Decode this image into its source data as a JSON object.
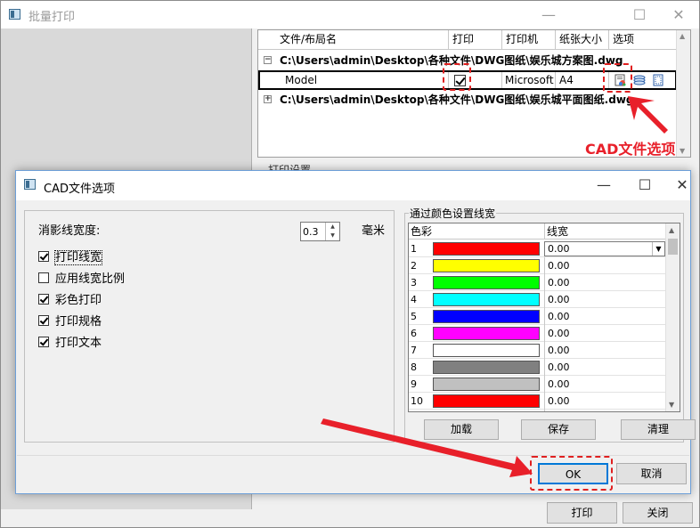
{
  "main_window": {
    "title": "批量打印",
    "controls": {
      "minimize": "—",
      "maximize": "☐",
      "close": "✕"
    },
    "file_tree": {
      "columns": [
        "文件/布局名",
        "打印",
        "打印机",
        "纸张大小",
        "选项"
      ],
      "rows": [
        {
          "expander": "−",
          "path": "C:\\Users\\admin\\Desktop\\各种文件\\DWG图纸\\娱乐城方案图.dwg"
        },
        {
          "layout": "Model",
          "print_checked": true,
          "printer": "Microsoft",
          "paper": "A4",
          "options_icons": [
            "cad-file-options-icon",
            "layers-icon",
            "page-setup-icon"
          ]
        },
        {
          "expander": "+",
          "path": "C:\\Users\\admin\\Desktop\\各种文件\\DWG图纸\\娱乐城平面图纸.dwg"
        }
      ]
    },
    "callout": "CAD文件选项",
    "print_settings_label": "打印设置",
    "buttons": {
      "print": "打印",
      "close": "关闭"
    }
  },
  "dialog": {
    "title": "CAD文件选项",
    "controls": {
      "minimize": "—",
      "maximize": "☐",
      "close": "✕"
    },
    "hidden_line_width": {
      "label": "消影线宽度:",
      "value": "0.3",
      "unit": "毫米"
    },
    "checkboxes": [
      {
        "label": "打印线宽",
        "checked": true
      },
      {
        "label": "应用线宽比例",
        "checked": false
      },
      {
        "label": "彩色打印",
        "checked": true
      },
      {
        "label": "打印规格",
        "checked": true
      },
      {
        "label": "打印文本",
        "checked": true
      }
    ],
    "color_group": {
      "title": "通过颜色设置线宽",
      "headers": {
        "color": "色彩",
        "line_width": "线宽"
      },
      "rows": [
        {
          "num": "1",
          "color": "#ff0000",
          "lw": "0.00"
        },
        {
          "num": "2",
          "color": "#ffff00",
          "lw": "0.00"
        },
        {
          "num": "3",
          "color": "#00ff00",
          "lw": "0.00"
        },
        {
          "num": "4",
          "color": "#00ffff",
          "lw": "0.00"
        },
        {
          "num": "5",
          "color": "#0000ff",
          "lw": "0.00"
        },
        {
          "num": "6",
          "color": "#ff00ff",
          "lw": "0.00"
        },
        {
          "num": "7",
          "color": "#ffffff",
          "lw": "0.00"
        },
        {
          "num": "8",
          "color": "#808080",
          "lw": "0.00"
        },
        {
          "num": "9",
          "color": "#c0c0c0",
          "lw": "0.00"
        },
        {
          "num": "10",
          "color": "#ff0000",
          "lw": "0.00"
        },
        {
          "num": "",
          "color": "#ff8080",
          "lw": ""
        }
      ],
      "buttons": {
        "load": "加载",
        "save": "保存",
        "clear": "清理"
      }
    },
    "buttons": {
      "ok": "OK",
      "cancel": "取消"
    }
  },
  "annotation_color": "#e8202a"
}
